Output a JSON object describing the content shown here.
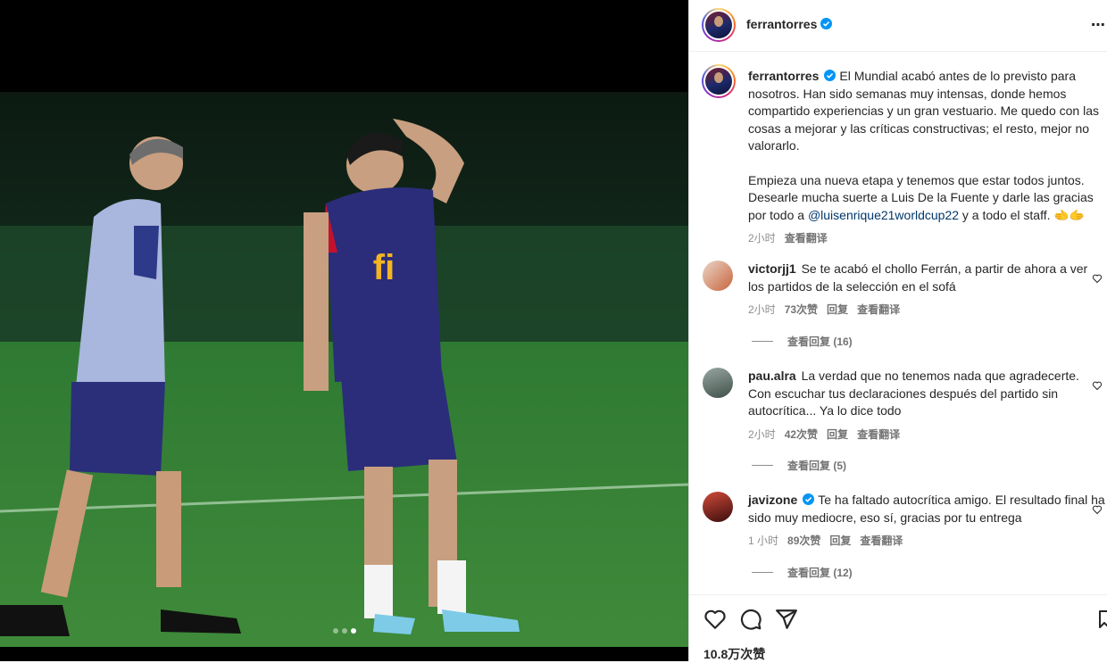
{
  "post": {
    "username": "ferrantorres",
    "caption_p1": "El Mundial acabó antes de lo previsto para nosotros. Han sido semanas muy intensas, donde hemos compartido experiencias y un gran vestuario. Me quedo con las cosas a mejorar y las críticas constructivas; el resto, mejor no valorarlo.",
    "caption_p2_a": "Empieza una nueva etapa y tenemos que estar todos juntos. Desearle mucha suerte a Luis De la Fuente y darle las gracias por todo a ",
    "caption_mention": "@luisenrique21worldcup22",
    "caption_p2_b": " y a todo el staff. 🫲🫱",
    "time": "2小时",
    "translate": "查看翻译",
    "more_icon": "more-options-icon",
    "likes": "10.8万次赞"
  },
  "comments": [
    {
      "username": "victorjj1",
      "verified": false,
      "text": "Se te acabó el chollo Ferrán, a partir de ahora a ver los partidos de la selección en el sofá",
      "time": "2小时",
      "likes": "73次赞",
      "reply": "回复",
      "translate": "查看翻译",
      "view_replies": "查看回复 (16)"
    },
    {
      "username": "pau.alra",
      "verified": false,
      "text": "La verdad que no tenemos nada que agradecerte. Con escuchar tus declaraciones después del partido sin autocrítica... Ya lo dice todo",
      "time": "2小时",
      "likes": "42次赞",
      "reply": "回复",
      "translate": "查看翻译",
      "view_replies": "查看回复 (5)"
    },
    {
      "username": "javizone",
      "verified": true,
      "text": "Te ha faltado autocrítica amigo. El resultado final ha sido muy mediocre, eso sí, gracias por tu entrega",
      "time": "1 小时",
      "likes": "89次赞",
      "reply": "回复",
      "translate": "查看翻译",
      "view_replies": "查看回复 (12)"
    }
  ],
  "icons": {
    "like": "heart-icon",
    "comment": "comment-icon",
    "share": "share-icon",
    "save": "bookmark-icon",
    "verified": "verified-badge-icon"
  },
  "colors": {
    "verified": "#0095f6",
    "mention": "#00376b",
    "meta": "#8e8e8e"
  },
  "carousel": {
    "total": 3,
    "active": 3
  }
}
